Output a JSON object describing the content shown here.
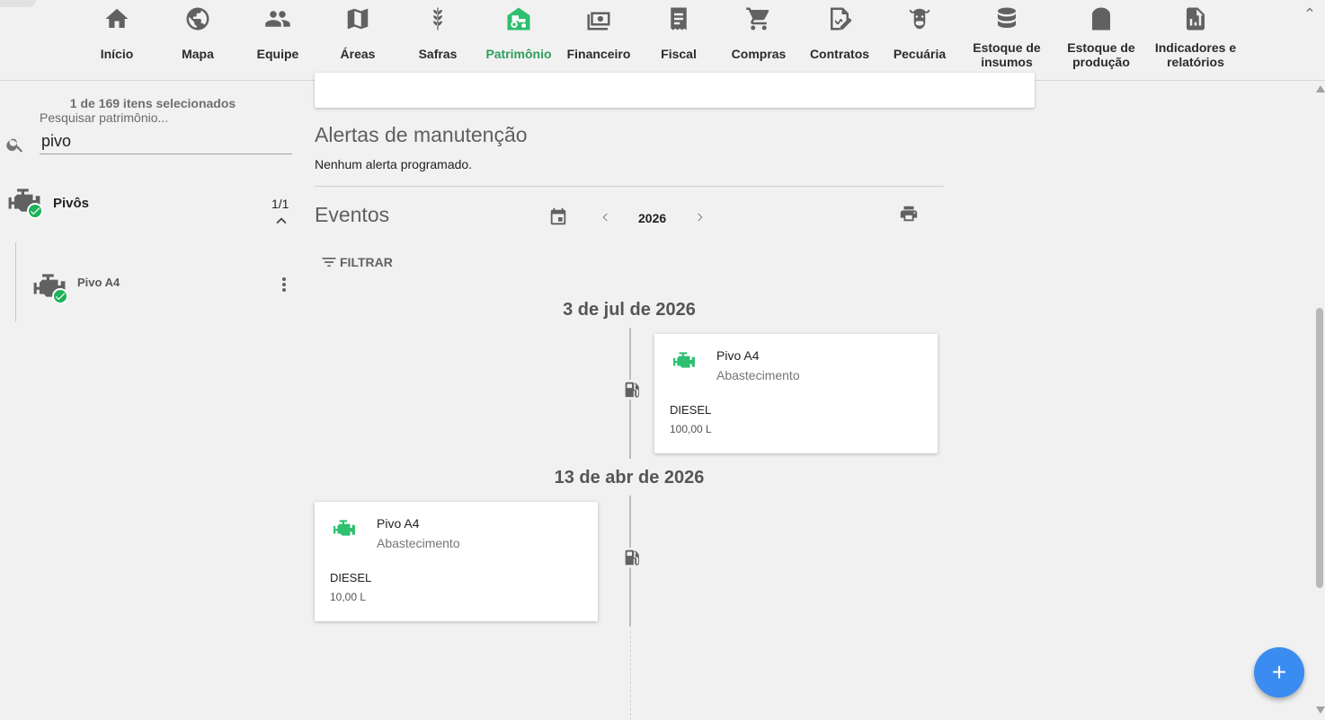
{
  "nav": {
    "items": [
      {
        "label": "Início",
        "icon": "home-icon"
      },
      {
        "label": "Mapa",
        "icon": "globe-icon"
      },
      {
        "label": "Equipe",
        "icon": "people-icon"
      },
      {
        "label": "Áreas",
        "icon": "map-icon"
      },
      {
        "label": "Safras",
        "icon": "wheat-icon"
      },
      {
        "label": "Patrimônio",
        "icon": "tractor-barn-icon",
        "active": true
      },
      {
        "label": "Financeiro",
        "icon": "money-icon"
      },
      {
        "label": "Fiscal",
        "icon": "receipt-icon"
      },
      {
        "label": "Compras",
        "icon": "cart-icon"
      },
      {
        "label": "Contratos",
        "icon": "contract-icon"
      },
      {
        "label": "Pecuária",
        "icon": "cow-icon"
      },
      {
        "label": "Estoque de insumos",
        "icon": "database-icon"
      },
      {
        "label": "Estoque de produção",
        "icon": "silo-icon"
      },
      {
        "label": "Indicadores e relatórios",
        "icon": "report-icon"
      }
    ],
    "active_color": "#2e9d5b"
  },
  "sidebar": {
    "selected_count": "1 de 169 itens selecionados",
    "search_label": "Pesquisar patrimônio...",
    "search_value": "pivo",
    "group": {
      "name": "Pivôs",
      "count": "1/1"
    },
    "items": [
      {
        "name": "Pivo A4"
      }
    ]
  },
  "main": {
    "alerts": {
      "title": "Alertas de manutenção",
      "text": "Nenhum alerta programado."
    },
    "events": {
      "title": "Eventos",
      "year": "2026",
      "filter_label": "FILTRAR",
      "groups": [
        {
          "date": "3 de jul de 2026",
          "side": "right",
          "event": {
            "asset": "Pivo A4",
            "type": "Abastecimento",
            "fuel": "DIESEL",
            "quantity": "100,00 L"
          }
        },
        {
          "date": "13 de abr de 2026",
          "side": "left",
          "event": {
            "asset": "Pivo A4",
            "type": "Abastecimento",
            "fuel": "DIESEL",
            "quantity": "10,00 L"
          }
        }
      ]
    }
  },
  "fab": {
    "label": "+",
    "color": "#3b8cf0"
  },
  "colors": {
    "success": "#1fb25a",
    "event_icon": "#2ebf6f"
  }
}
